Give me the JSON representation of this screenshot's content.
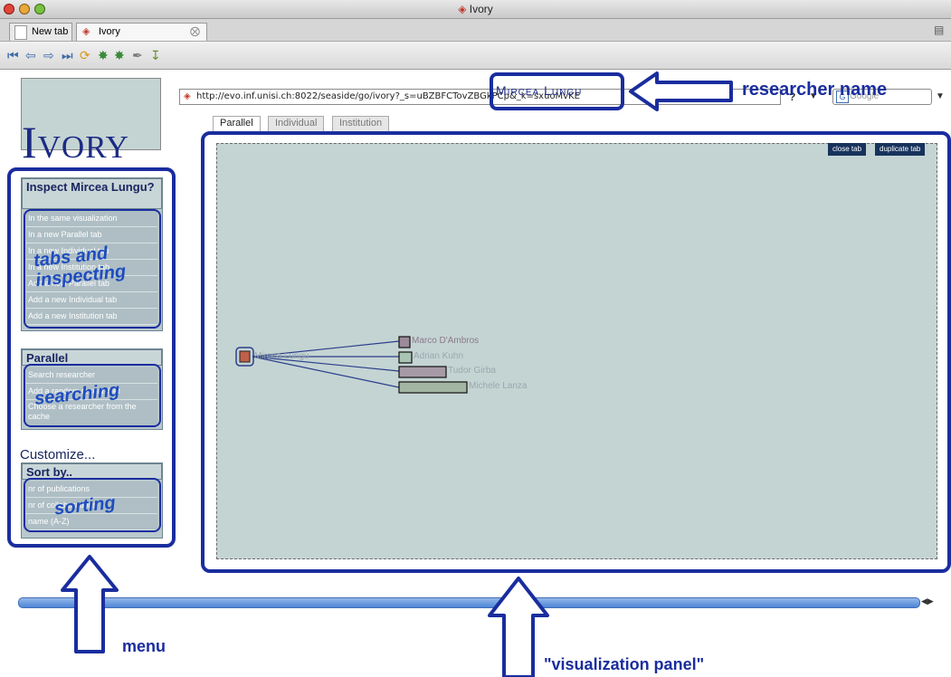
{
  "window": {
    "title": "Ivory"
  },
  "browser_tabs": [
    {
      "label": "New tab"
    },
    {
      "label": "Ivory"
    }
  ],
  "address_bar": {
    "url": "http://evo.inf.unisi.ch:8022/seaside/go/ivory?_s=uBZBFCTovZBGkPCp&_k=sxuoMvKE"
  },
  "search_bar": {
    "placeholder": "Google"
  },
  "logo": {
    "text": "Ivory"
  },
  "researcher": {
    "name": "Mircea Lungu"
  },
  "inspect_panel": {
    "title": "Inspect Mircea Lungu?",
    "items": [
      {
        "label": "In the same visualization"
      },
      {
        "label": "In a new Parallel tab"
      },
      {
        "label": "In a new Individual tab"
      },
      {
        "label": "In a new Institution tab"
      },
      {
        "label": "Add a new Parallel tab"
      },
      {
        "label": "Add a new Individual tab"
      },
      {
        "label": "Add a new Institution tab"
      }
    ]
  },
  "parallel_panel": {
    "title": "Parallel",
    "items": [
      {
        "label": "Search researcher"
      },
      {
        "label": "Add a random researcher"
      },
      {
        "label": "Choose a researcher from the cache"
      }
    ]
  },
  "customize": {
    "label": "Customize..."
  },
  "sort_panel": {
    "title": "Sort by..",
    "items": [
      {
        "label": "nr of publications"
      },
      {
        "label": "nr of collaborations"
      },
      {
        "label": "name (A-Z)"
      }
    ]
  },
  "page_tabs": [
    {
      "label": "Parallel",
      "active": true
    },
    {
      "label": "Individual",
      "active": false
    },
    {
      "label": "Institution",
      "active": false
    }
  ],
  "viz_buttons": {
    "close": "close tab",
    "duplicate": "duplicate tab"
  },
  "visualization": {
    "root": {
      "label": "Mircea Lungu",
      "color": "#c0604a"
    },
    "nodes": [
      {
        "label": "Marco D'Ambros",
        "color": "#9c8a9a"
      },
      {
        "label": "Adrian Kuhn",
        "color": "#a9c4b4"
      },
      {
        "label": "Tudor Girba",
        "color": "#a69aa6"
      },
      {
        "label": "Michele Lanza",
        "color": "#a3b5a3"
      }
    ]
  },
  "annotations": {
    "researcher_name": "researcher name",
    "tabs_inspecting": "tabs and inspecting",
    "searching": "searching",
    "sorting": "sorting",
    "menu": "menu",
    "visualization_panel": "\"visualization panel\""
  },
  "colors": {
    "accent": "#1c2a84",
    "annotation": "#1e4cc0",
    "viz_bg": "#c4d4d3",
    "menu_item": "#aebec4"
  }
}
